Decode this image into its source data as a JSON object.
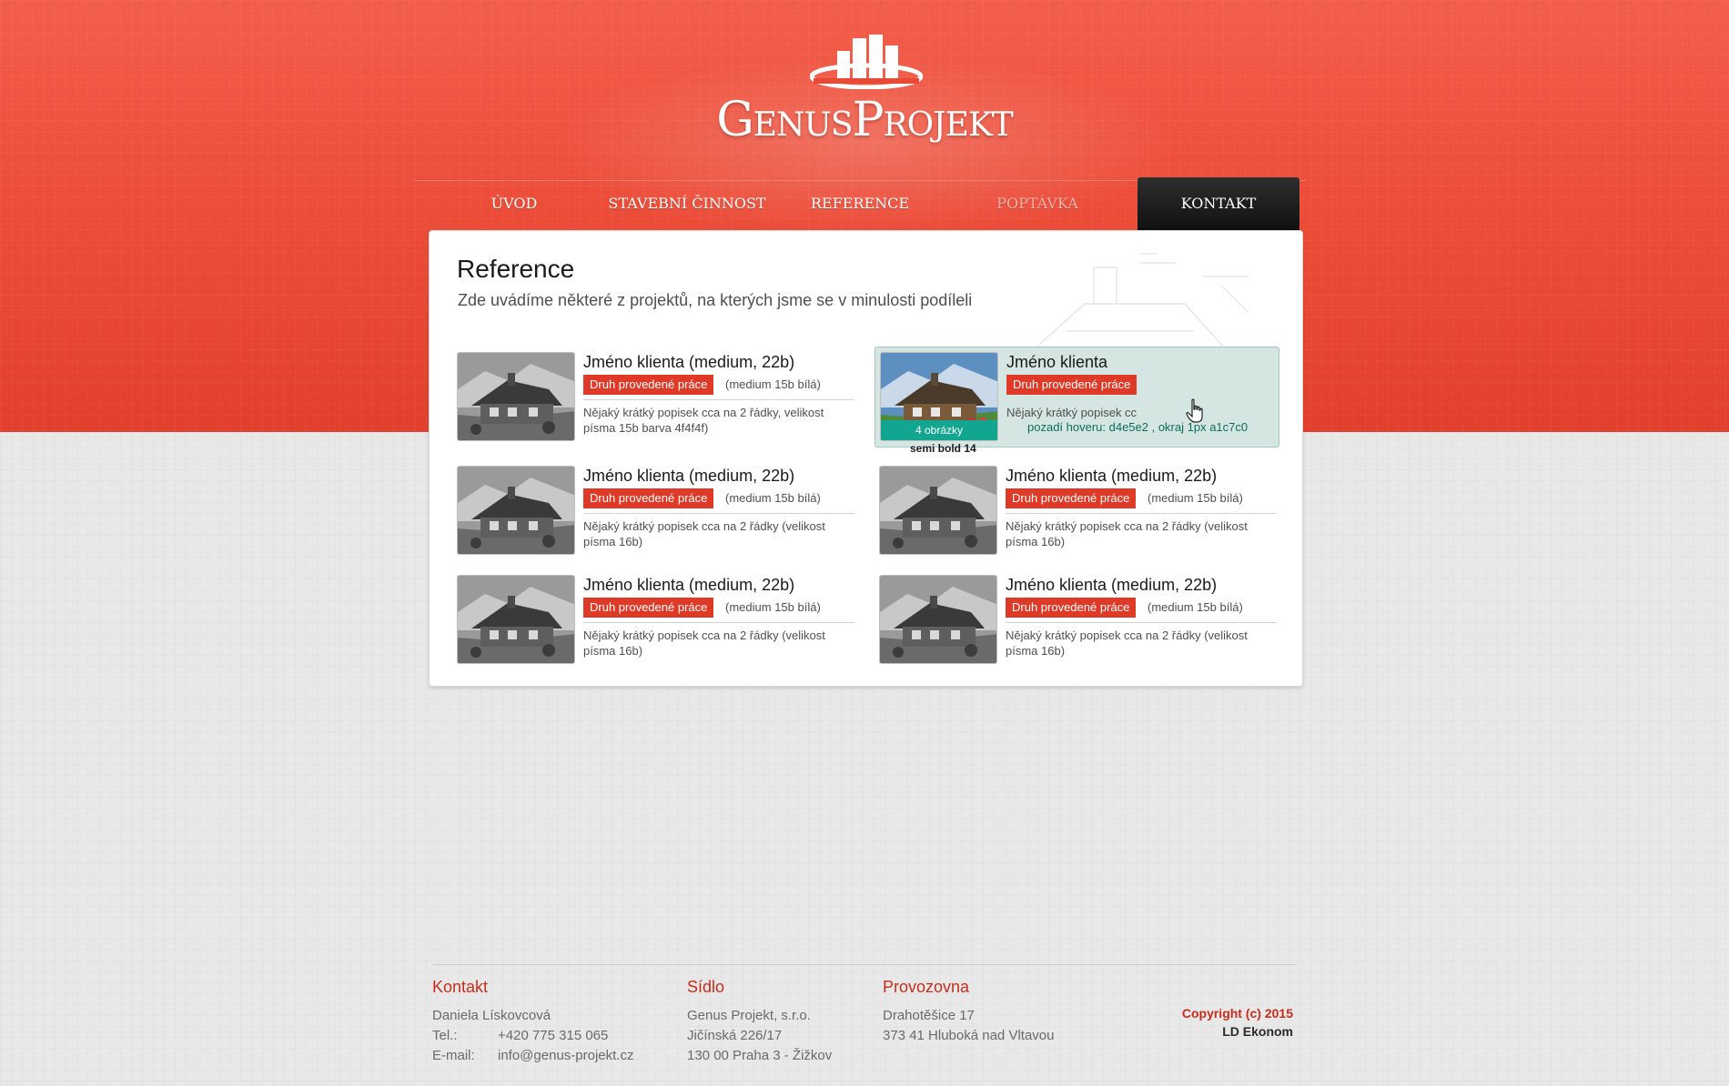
{
  "brand": {
    "name_part1": "Genus",
    "name_part2": "Projekt"
  },
  "nav": {
    "items": [
      {
        "label": "ÚVOD"
      },
      {
        "label": "STAVEBNÍ ČINNOST"
      },
      {
        "label": "REFERENCE"
      },
      {
        "label": "POPTÁVKA"
      },
      {
        "label": "KONTAKT"
      }
    ]
  },
  "main": {
    "title": "Reference",
    "subtitle": "Zde uvádíme některé z projektů, na kterých jsme se v minulosti podíleli",
    "references": [
      {
        "name": "Jméno klienta (medium, 22b)",
        "type": "Druh provedené práce",
        "note": "(medium 15b bílá)",
        "desc": "Nějaký krátký popisek cca na 2 řádky, velikost písma 15b barva 4f4f4f)"
      },
      {
        "name": "Jméno klienta",
        "type": "Druh provedené práce",
        "desc": "Nějaký krátký popisek cc",
        "badge": "4 obrázky",
        "hover_note": "pozadí hoveru: d4e5e2 , okraj 1px a1c7c0",
        "badge_note": "semi bold 14"
      },
      {
        "name": "Jméno klienta (medium, 22b)",
        "type": "Druh provedené práce",
        "note": "(medium 15b bílá)",
        "desc": "Nějaký krátký popisek cca na 2 řádky (velikost písma 16b)"
      },
      {
        "name": "Jméno klienta (medium, 22b)",
        "type": "Druh provedené práce",
        "note": "(medium 15b bílá)",
        "desc": "Nějaký krátký popisek cca na 2 řádky (velikost písma 16b)"
      },
      {
        "name": "Jméno klienta (medium, 22b)",
        "type": "Druh provedené práce",
        "note": "(medium 15b bílá)",
        "desc": "Nějaký krátký popisek cca na 2 řádky (velikost písma 16b)"
      },
      {
        "name": "Jméno klienta (medium, 22b)",
        "type": "Druh provedené práce",
        "note": "(medium 15b bílá)",
        "desc": "Nějaký krátký popisek cca na 2 řádky (velikost písma 16b)"
      }
    ]
  },
  "footer": {
    "contact": {
      "heading": "Kontakt",
      "person": "Daniela Lískovcová",
      "tel_label": "Tel.:",
      "tel": "+420 775 315 065",
      "email_label": "E-mail:",
      "email": "info@genus-projekt.cz"
    },
    "seat": {
      "heading": "Sídlo",
      "lines": [
        "Genus Projekt, s.r.o.",
        "Jičínská 226/17",
        "130 00  Praha 3 - Žižkov"
      ]
    },
    "office": {
      "heading": "Provozovna",
      "lines": [
        "Drahotěšice 17",
        "373 41  Hluboká nad Vltavou"
      ]
    },
    "copyright": "Copyright (c) 2015",
    "author": "LD Ekonom"
  },
  "colors": {
    "brand_red": "#e84a36",
    "accent_red": "#df3a28",
    "hover_bg": "#d4e5e2",
    "hover_border": "#a1c7c0",
    "badge_teal": "#12a58f",
    "text": "#4f4f4f"
  }
}
